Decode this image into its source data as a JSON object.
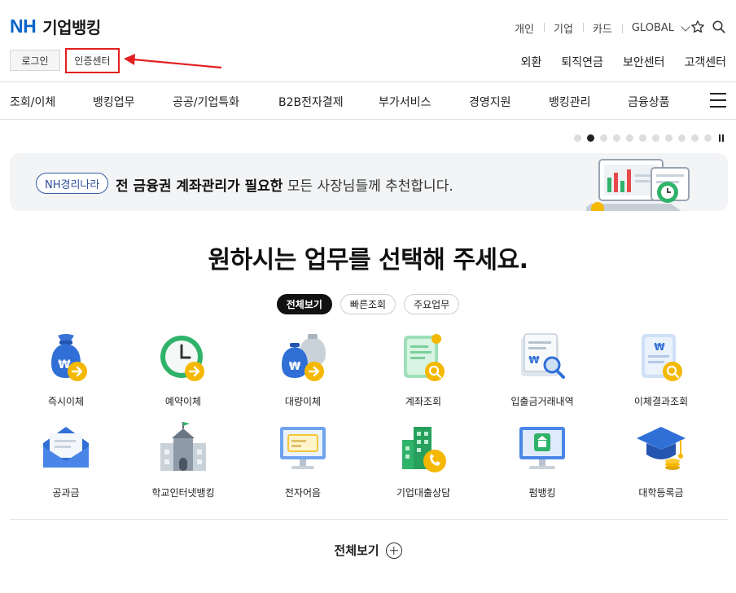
{
  "header": {
    "logo_nh": "NH",
    "logo_text": "기업뱅킹",
    "top_links": [
      "개인",
      "기업",
      "카드",
      "GLOBAL"
    ],
    "login_label": "로그인",
    "cert_label": "인증센터",
    "util_links": [
      "외환",
      "퇴직연금",
      "보안센터",
      "고객센터"
    ]
  },
  "gnb": [
    "조회/이체",
    "뱅킹업무",
    "공공/기업특화",
    "B2B전자결제",
    "부가서비스",
    "경영지원",
    "뱅킹관리",
    "금융상품"
  ],
  "carousel": {
    "dot_count": 11,
    "active_index": 1
  },
  "banner": {
    "badge": "NH경리나라",
    "bold_text": "전 금융권 계좌관리가 필요한",
    "rest_text": " 모든 사장님들께 추천합니다."
  },
  "main": {
    "title": "원하시는 업무를 선택해 주세요.",
    "tabs": [
      "전체보기",
      "빠른조회",
      "주요업무"
    ],
    "services": [
      {
        "label": "즉시이체",
        "icon": "money-bag-arrow-icon"
      },
      {
        "label": "예약이체",
        "icon": "clock-arrow-icon"
      },
      {
        "label": "대량이체",
        "icon": "money-bags-arrow-icon"
      },
      {
        "label": "계좌조회",
        "icon": "document-search-icon"
      },
      {
        "label": "입출금거래내역",
        "icon": "receipt-search-icon"
      },
      {
        "label": "이체결과조회",
        "icon": "won-document-search-icon"
      },
      {
        "label": "공과금",
        "icon": "envelope-icon"
      },
      {
        "label": "학교인터넷뱅킹",
        "icon": "school-icon"
      },
      {
        "label": "전자어음",
        "icon": "monitor-bill-icon"
      },
      {
        "label": "기업대출상담",
        "icon": "building-phone-icon"
      },
      {
        "label": "펌뱅킹",
        "icon": "monitor-bank-icon"
      },
      {
        "label": "대학등록금",
        "icon": "graduation-cap-icon"
      }
    ],
    "view_all": "전체보기"
  },
  "colors": {
    "brand": "#0a64c8",
    "highlight": "#e32020",
    "accent_yellow": "#f5b800",
    "icon_blue": "#2f6fd6"
  }
}
